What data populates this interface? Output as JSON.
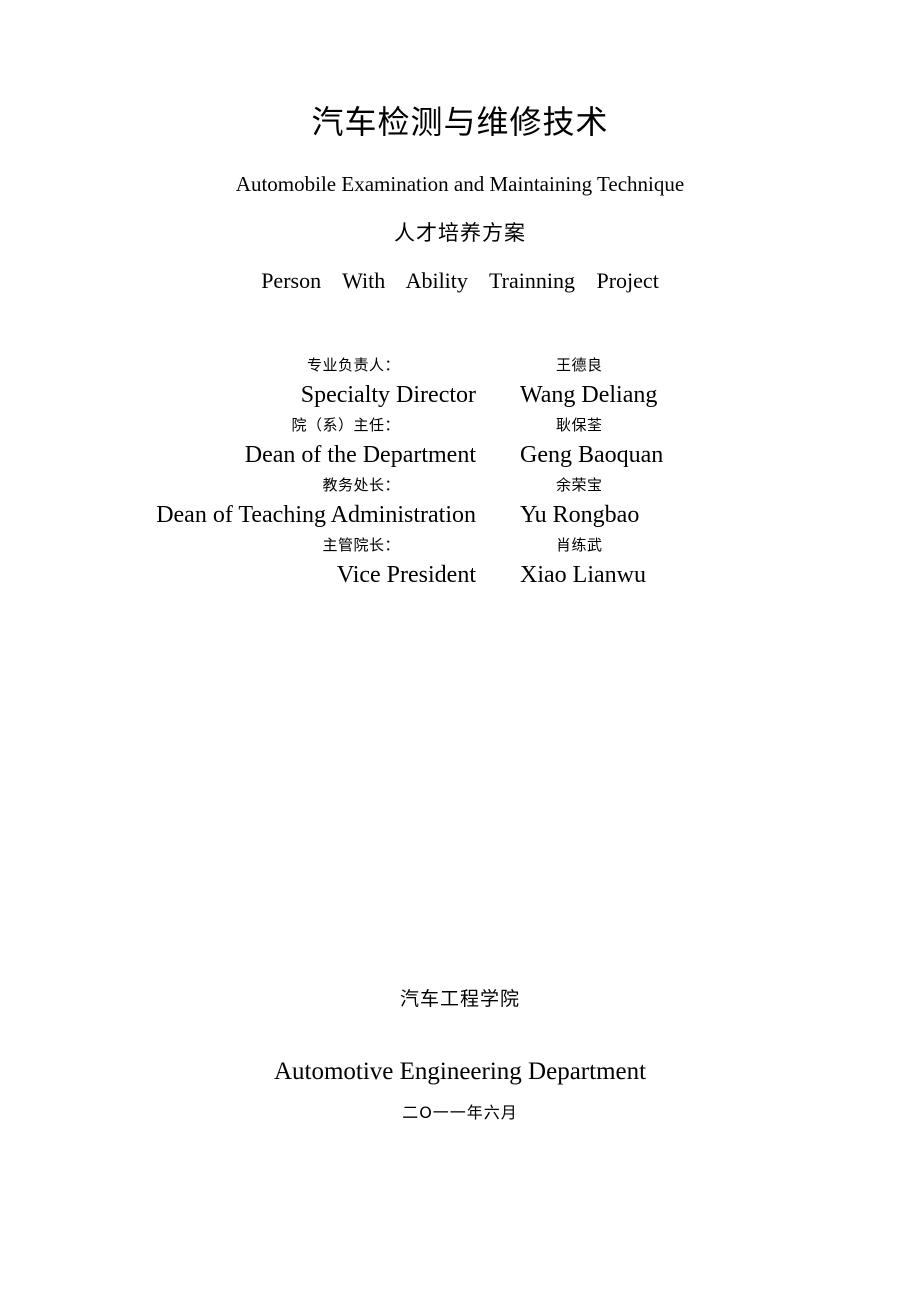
{
  "document": {
    "title_cn": "汽车检测与维修技术",
    "title_en": "Automobile Examination and Maintaining Technique",
    "subtitle_cn": "人才培养方案",
    "subtitle_en": "Person  With  Ability  Trainning  Project"
  },
  "signatures": [
    {
      "label_cn": "专业负责人：",
      "name_cn": "王德良",
      "role_en": "Specialty Director",
      "name_en": "Wang Deliang"
    },
    {
      "label_cn": "院（系）主任：",
      "name_cn": "耿保荃",
      "role_en": "Dean of the Department",
      "name_en": "Geng Baoquan"
    },
    {
      "label_cn": "教务处长：",
      "name_cn": "余荣宝",
      "role_en": "Dean of Teaching Administration",
      "name_en": "Yu Rongbao"
    },
    {
      "label_cn": "主管院长：",
      "name_cn": "肖练武",
      "role_en": "Vice President",
      "name_en": "Xiao Lianwu"
    }
  ],
  "footer": {
    "department_cn": "汽车工程学院",
    "department_en": "Automotive Engineering Department",
    "date": "二O一一年六月"
  }
}
